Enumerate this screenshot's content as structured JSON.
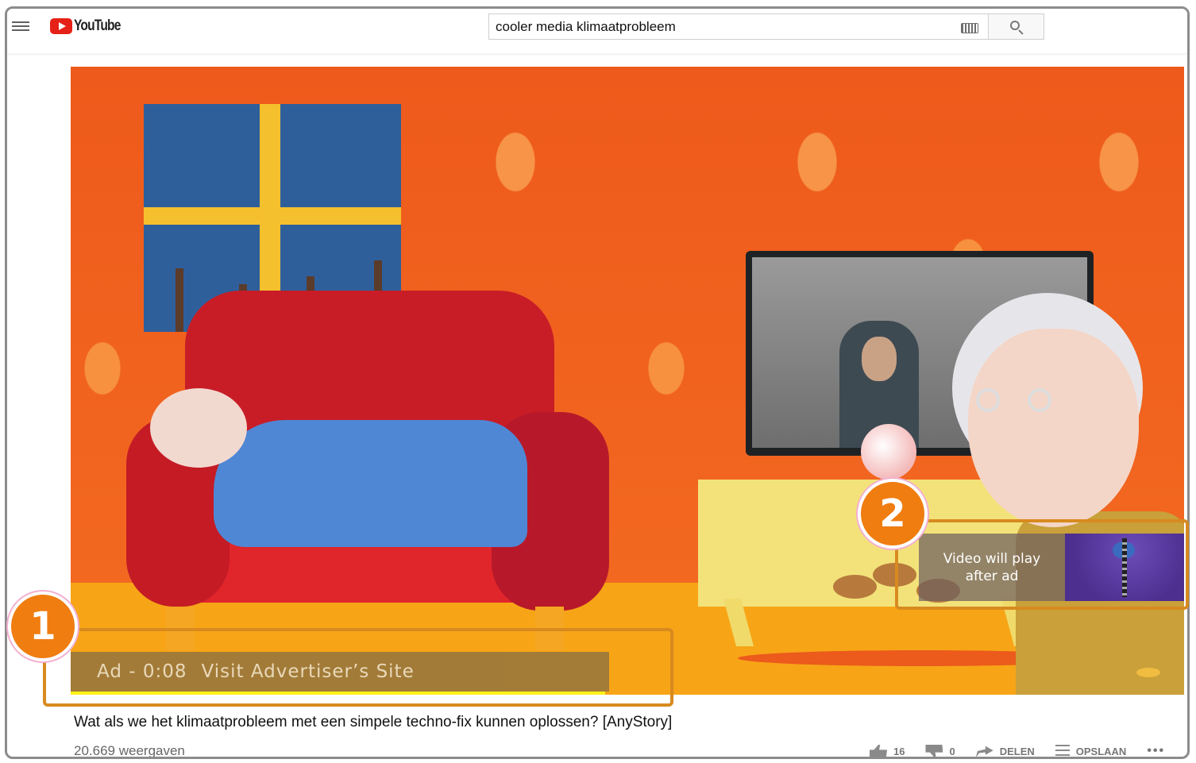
{
  "header": {
    "logo_text": "YouTube",
    "search_value": "cooler media klimaatprobleem"
  },
  "player": {
    "ad_label": "Ad - 0:08",
    "ad_link": "Visit Advertiser’s Site",
    "ad_progress_fraction": 0.48,
    "preview_line1": "Video will play",
    "preview_line2": "after ad"
  },
  "annotations": {
    "badge1": "1",
    "badge2": "2",
    "color": "#f07d10"
  },
  "video": {
    "title": "Wat als we het klimaatprobleem met een simpele techno-fix kunnen oplossen? [AnyStory]",
    "views": "20.669 weergaven",
    "likes": "16",
    "dislikes": "0",
    "share_label": "DELEN",
    "save_label": "OPSLAAN",
    "more_label": "•••"
  },
  "colors": {
    "brand_red": "#e62117",
    "ad_bar": "#9f7a3a",
    "progress": "#fff21a"
  }
}
